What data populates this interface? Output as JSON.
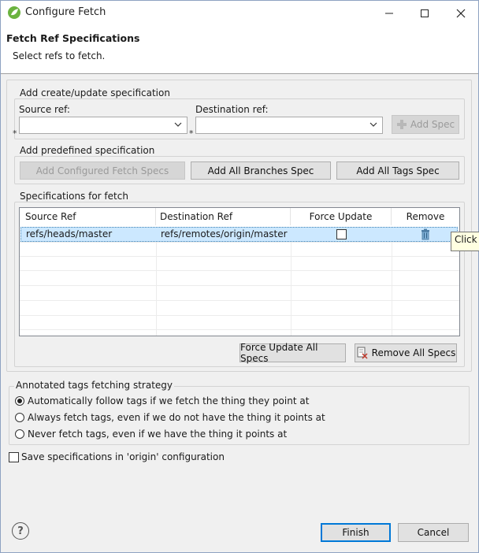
{
  "window": {
    "title": "Configure Fetch",
    "minimize": "—",
    "maximize": "☐",
    "close": "✕"
  },
  "header": {
    "title": "Fetch Ref Specifications",
    "subtitle": "Select refs to fetch."
  },
  "create_group": {
    "label": "Add create/update specification",
    "source_label": "Source ref:",
    "destination_label": "Destination ref:",
    "source_value": "",
    "destination_value": "",
    "required_marker": "*",
    "add_spec": "Add Spec"
  },
  "predefined_group": {
    "label": "Add predefined specification",
    "configured": "Add Configured Fetch Specs",
    "branches": "Add All Branches Spec",
    "tags": "Add All Tags Spec"
  },
  "specs_group": {
    "label": "Specifications for fetch",
    "columns": [
      "Source Ref",
      "Destination Ref",
      "Force Update",
      "Remove"
    ],
    "rows": [
      {
        "source": "refs/heads/master",
        "destination": "refs/remotes/origin/master",
        "force": false
      }
    ],
    "tooltip": "Click t",
    "force_all": "Force Update All Specs",
    "remove_all": "Remove All Specs"
  },
  "tags_group": {
    "label": "Annotated tags fetching strategy",
    "options": [
      {
        "label": "Automatically follow tags if we fetch the thing they point at",
        "selected": true
      },
      {
        "label": "Always fetch tags, even if we do not have the thing it points at",
        "selected": false
      },
      {
        "label": "Never fetch tags, even if we have the thing it points at",
        "selected": false
      }
    ]
  },
  "save_config": {
    "label": "Save specifications in 'origin' configuration",
    "checked": false
  },
  "footer": {
    "help": "?",
    "finish": "Finish",
    "cancel": "Cancel"
  },
  "colors": {
    "accent": "#3c7fb1",
    "spring_green": "#6bb33f",
    "selection": "#cce8ff"
  }
}
